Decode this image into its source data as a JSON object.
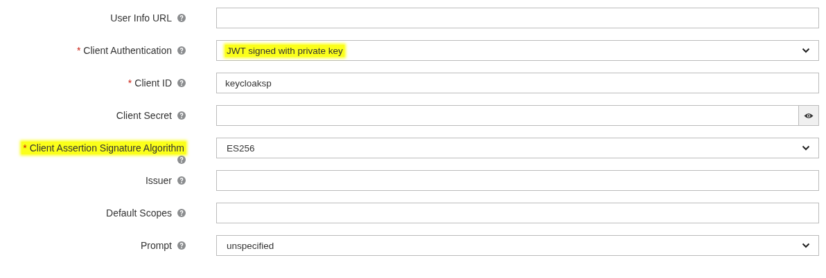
{
  "fields": [
    {
      "label": "User Info URL",
      "required": false,
      "kind": "text",
      "label_highlighted": false
    },
    {
      "label": "Client Authentication",
      "required": true,
      "required_mark": "*",
      "kind": "select",
      "value": "JWT signed with private key",
      "label_highlighted": false,
      "value_highlighted": true
    },
    {
      "label": "Client ID",
      "required": true,
      "required_mark": "*",
      "kind": "text",
      "value": "keycloaksp",
      "label_highlighted": false
    },
    {
      "label": "Client Secret",
      "required": false,
      "kind": "password",
      "label_highlighted": false
    },
    {
      "label": "Client Assertion Signature Algorithm",
      "required": true,
      "required_mark": "*",
      "kind": "select",
      "value": "ES256",
      "label_highlighted": true,
      "value_highlighted": false
    },
    {
      "label": "Issuer",
      "required": false,
      "kind": "text",
      "label_highlighted": false
    },
    {
      "label": "Default Scopes",
      "required": false,
      "kind": "text",
      "label_highlighted": false
    },
    {
      "label": "Prompt",
      "required": false,
      "kind": "select",
      "value": "unspecified",
      "label_highlighted": false,
      "value_highlighted": false
    }
  ]
}
